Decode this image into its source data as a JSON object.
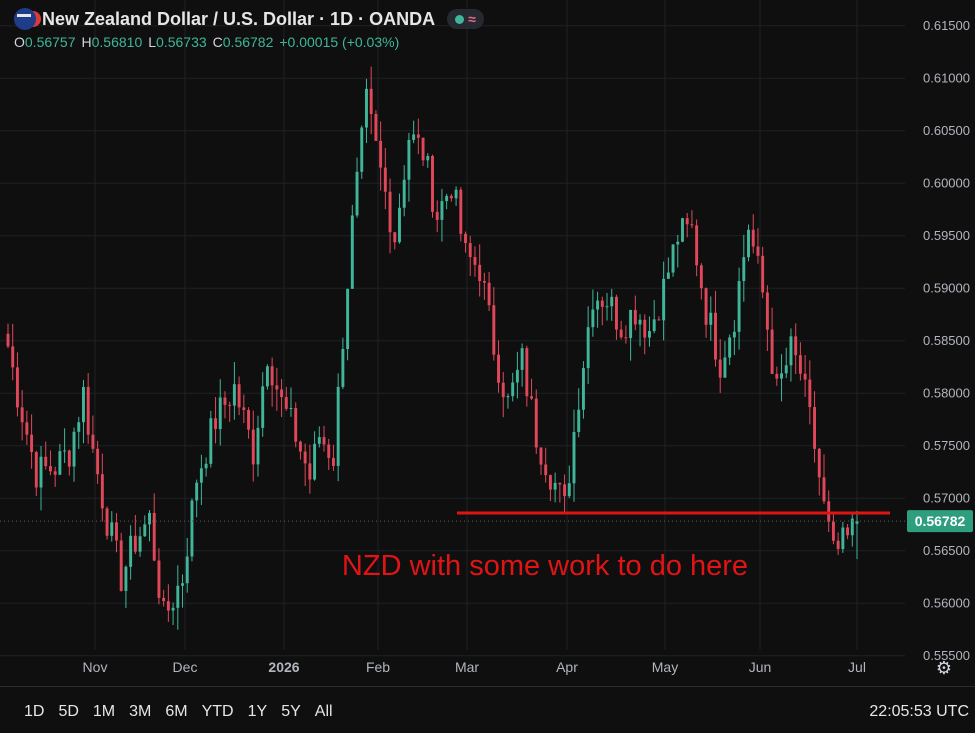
{
  "header": {
    "title": "New Zealand Dollar / U.S. Dollar · 1D · OANDA",
    "ohlc": [
      {
        "key": "O",
        "value": "0.56757"
      },
      {
        "key": "H",
        "value": "0.56810"
      },
      {
        "key": "L",
        "value": "0.56733"
      },
      {
        "key": "C",
        "value": "0.56782"
      }
    ],
    "change": "+0.00015 (+0.03%)"
  },
  "colors": {
    "up": "#3fb69a",
    "down": "#e0485a",
    "annotation": "#e01414",
    "price_badge": "#2f9e7f",
    "grid": "#1e2126",
    "axis_text": "#b2b5be"
  },
  "chart_data": {
    "type": "candlestick",
    "y_ticks": [
      "0.61500",
      "0.61000",
      "0.60500",
      "0.60000",
      "0.59500",
      "0.59000",
      "0.58500",
      "0.58000",
      "0.57500",
      "0.57000",
      "0.56500",
      "0.56000",
      "0.55500"
    ],
    "ylim": [
      0.5525,
      0.6165
    ],
    "x_ticks": [
      "Nov",
      "Dec",
      "2026",
      "Feb",
      "Mar",
      "Apr",
      "May",
      "Jun",
      "Jul"
    ],
    "current_price": "0.56782",
    "support_level": 0.5686,
    "annotation": "NZD with some work to do here",
    "waypoints": [
      [
        0,
        0.5845
      ],
      [
        2,
        0.58
      ],
      [
        6,
        0.5725
      ],
      [
        10,
        0.573
      ],
      [
        13,
        0.5745
      ],
      [
        16,
        0.58
      ],
      [
        18,
        0.5745
      ],
      [
        21,
        0.568
      ],
      [
        24,
        0.5625
      ],
      [
        27,
        0.566
      ],
      [
        30,
        0.568
      ],
      [
        33,
        0.5585
      ],
      [
        37,
        0.5625
      ],
      [
        40,
        0.572
      ],
      [
        44,
        0.5775
      ],
      [
        48,
        0.5805
      ],
      [
        52,
        0.5745
      ],
      [
        55,
        0.584
      ],
      [
        58,
        0.579
      ],
      [
        61,
        0.576
      ],
      [
        64,
        0.572
      ],
      [
        66,
        0.576
      ],
      [
        69,
        0.574
      ],
      [
        71,
        0.5855
      ],
      [
        73,
        0.596
      ],
      [
        76,
        0.6075
      ],
      [
        79,
        0.601
      ],
      [
        82,
        0.595
      ],
      [
        85,
        0.6045
      ],
      [
        88,
        0.603
      ],
      [
        91,
        0.597
      ],
      [
        94,
        0.6
      ],
      [
        97,
        0.593
      ],
      [
        100,
        0.592
      ],
      [
        103,
        0.5845
      ],
      [
        106,
        0.579
      ],
      [
        109,
        0.583
      ],
      [
        112,
        0.576
      ],
      [
        115,
        0.5725
      ],
      [
        118,
        0.569
      ],
      [
        121,
        0.58
      ],
      [
        124,
        0.5895
      ],
      [
        127,
        0.589
      ],
      [
        130,
        0.5865
      ],
      [
        133,
        0.588
      ],
      [
        136,
        0.586
      ],
      [
        139,
        0.59
      ],
      [
        142,
        0.595
      ],
      [
        145,
        0.5955
      ],
      [
        148,
        0.588
      ],
      [
        151,
        0.583
      ],
      [
        154,
        0.5875
      ],
      [
        157,
        0.596
      ],
      [
        160,
        0.5895
      ],
      [
        163,
        0.58
      ],
      [
        166,
        0.584
      ],
      [
        168,
        0.582
      ],
      [
        171,
        0.575
      ],
      [
        173,
        0.569
      ],
      [
        175,
        0.5645
      ],
      [
        178,
        0.566
      ],
      [
        180,
        0.56782
      ]
    ]
  },
  "bottom_bar": {
    "ranges": [
      "1D",
      "5D",
      "1M",
      "3M",
      "6M",
      "YTD",
      "1Y",
      "5Y",
      "All"
    ],
    "clock": "22:05:53 UTC"
  }
}
